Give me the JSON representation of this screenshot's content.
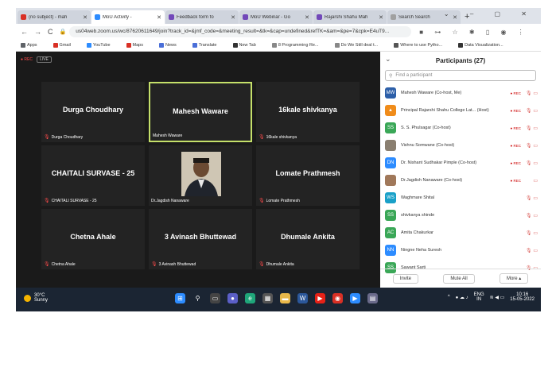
{
  "tabs": [
    {
      "label": "(no subject) - mah",
      "color": "#d93025",
      "active": false
    },
    {
      "label": "MoU Activity -",
      "color": "#2d8cff",
      "active": true
    },
    {
      "label": "Feedback form fo",
      "color": "#7248b9",
      "active": false
    },
    {
      "label": "MoU Webinar - Go",
      "color": "#7248b9",
      "active": false
    },
    {
      "label": "Rajarshi Shahu Mah",
      "color": "#7248b9",
      "active": false
    },
    {
      "label": "Search Search",
      "color": "#a0a0a0",
      "active": false
    }
  ],
  "address": {
    "url": "us04web.zoom.us/wc/87620611649/join?track_id=&jmf_code=&meeting_result=&tk=&cap=undefined&refTK=&am=&pe=7&cpk=E4uT9..."
  },
  "bookmarks": [
    {
      "label": "Apps",
      "color": "#5f6368"
    },
    {
      "label": "Gmail",
      "color": "#d93025"
    },
    {
      "label": "YouTube",
      "color": "#2d8cff"
    },
    {
      "label": "Maps",
      "color": "#d93025"
    },
    {
      "label": "News",
      "color": "#4a6fd8"
    },
    {
      "label": "Translate",
      "color": "#4a6fd8"
    },
    {
      "label": "New Tab",
      "color": "#333333"
    },
    {
      "label": "8 Programming Re...",
      "color": "#888888"
    },
    {
      "label": "Do We Still deal t...",
      "color": "#888888"
    },
    {
      "label": "Where to use Pytho...",
      "color": "#555555"
    },
    {
      "label": "Data Visualization...",
      "color": "#333333"
    }
  ],
  "meeting": {
    "rec_label": "● REC",
    "live_label": "LIVE",
    "tiles": [
      {
        "big": "Durga Choudhary",
        "small": "Durga Choudhary",
        "muted": true,
        "active": false,
        "photo": false
      },
      {
        "big": "Mahesh Waware",
        "small": "Mahesh Waware",
        "muted": false,
        "active": true,
        "photo": false
      },
      {
        "big": "16kale shivkanya",
        "small": "16kale shivkanya",
        "muted": true,
        "active": false,
        "photo": false
      },
      {
        "big": "CHAITALI SURVASE - 25",
        "small": "CHAITALI SURVASE - 25",
        "muted": true,
        "active": false,
        "photo": false
      },
      {
        "big": "",
        "small": "Dr.Jagdish Nanaware",
        "muted": false,
        "active": false,
        "photo": true
      },
      {
        "big": "Lomate Prathmesh",
        "small": "Lomate Prathmesh",
        "muted": true,
        "active": false,
        "photo": false
      },
      {
        "big": "Chetna Ahale",
        "small": "Chetna Ahale",
        "muted": true,
        "active": false,
        "photo": false
      },
      {
        "big": "3 Avinash Bhuttewad",
        "small": "3 Avinash Bhuttewad",
        "muted": true,
        "active": false,
        "photo": false
      },
      {
        "big": "Dhumale Ankita",
        "small": "Dhumale Ankita",
        "muted": true,
        "active": false,
        "photo": false
      }
    ]
  },
  "participants": {
    "title": "Participants (27)",
    "search_placeholder": "Find a participant",
    "list": [
      {
        "initials": "MW",
        "color": "#2d5fa8",
        "name": "Mahesh Waware (Co-host, Me)",
        "rec": "● REC",
        "icons": "🎙 ▭"
      },
      {
        "initials": "▲",
        "color": "#f08c1a",
        "name": "Principal Rajarshi Shahu College Lat... (Host)",
        "rec": "● REC",
        "icons": "🎙 ▭"
      },
      {
        "initials": "SS",
        "color": "#3aa757",
        "name": "S. S. Phulsagar (Co-host)",
        "rec": "● REC",
        "icons": "🎙 ▭"
      },
      {
        "initials": "",
        "color": "#8a7f70",
        "name": "Vishnu Somwane (Co-host)",
        "rec": "● REC",
        "icons": "🎙 ▭"
      },
      {
        "initials": "DN",
        "color": "#2d8cff",
        "name": "Dr. Nishant Sudhakar Pimple (Co-host)",
        "rec": "● REC",
        "icons": "🎙 ▭"
      },
      {
        "initials": "",
        "color": "#a0785a",
        "name": "Dr.Jagdish Nanaware (Co-host)",
        "rec": "● REC",
        "icons": "▭"
      },
      {
        "initials": "WS",
        "color": "#19a0c8",
        "name": "Waghmare Shital",
        "rec": "",
        "icons": "🎙 ▭"
      },
      {
        "initials": "SS",
        "color": "#3aa757",
        "name": "shivkanya shinde",
        "rec": "",
        "icons": "🎙 ▭"
      },
      {
        "initials": "AC",
        "color": "#3aa757",
        "name": "Amita Chakurkar",
        "rec": "",
        "icons": "🎙 ▭"
      },
      {
        "initials": "NN",
        "color": "#2d8cff",
        "name": "Ningne Neha Suresh",
        "rec": "",
        "icons": "🎙 ▭"
      },
      {
        "initials": "SS",
        "color": "#3aa757",
        "name": "Sawant Sarti",
        "rec": "",
        "icons": "🎙 ▭"
      }
    ],
    "invite_label": "Invite",
    "mute_all_label": "Mute All",
    "more_label": "More ▴"
  },
  "taskbar": {
    "temp": "30°C",
    "weather": "Sunny",
    "lang": "ENG",
    "region": "IN",
    "time": "10:16",
    "date": "15-05-2022"
  }
}
